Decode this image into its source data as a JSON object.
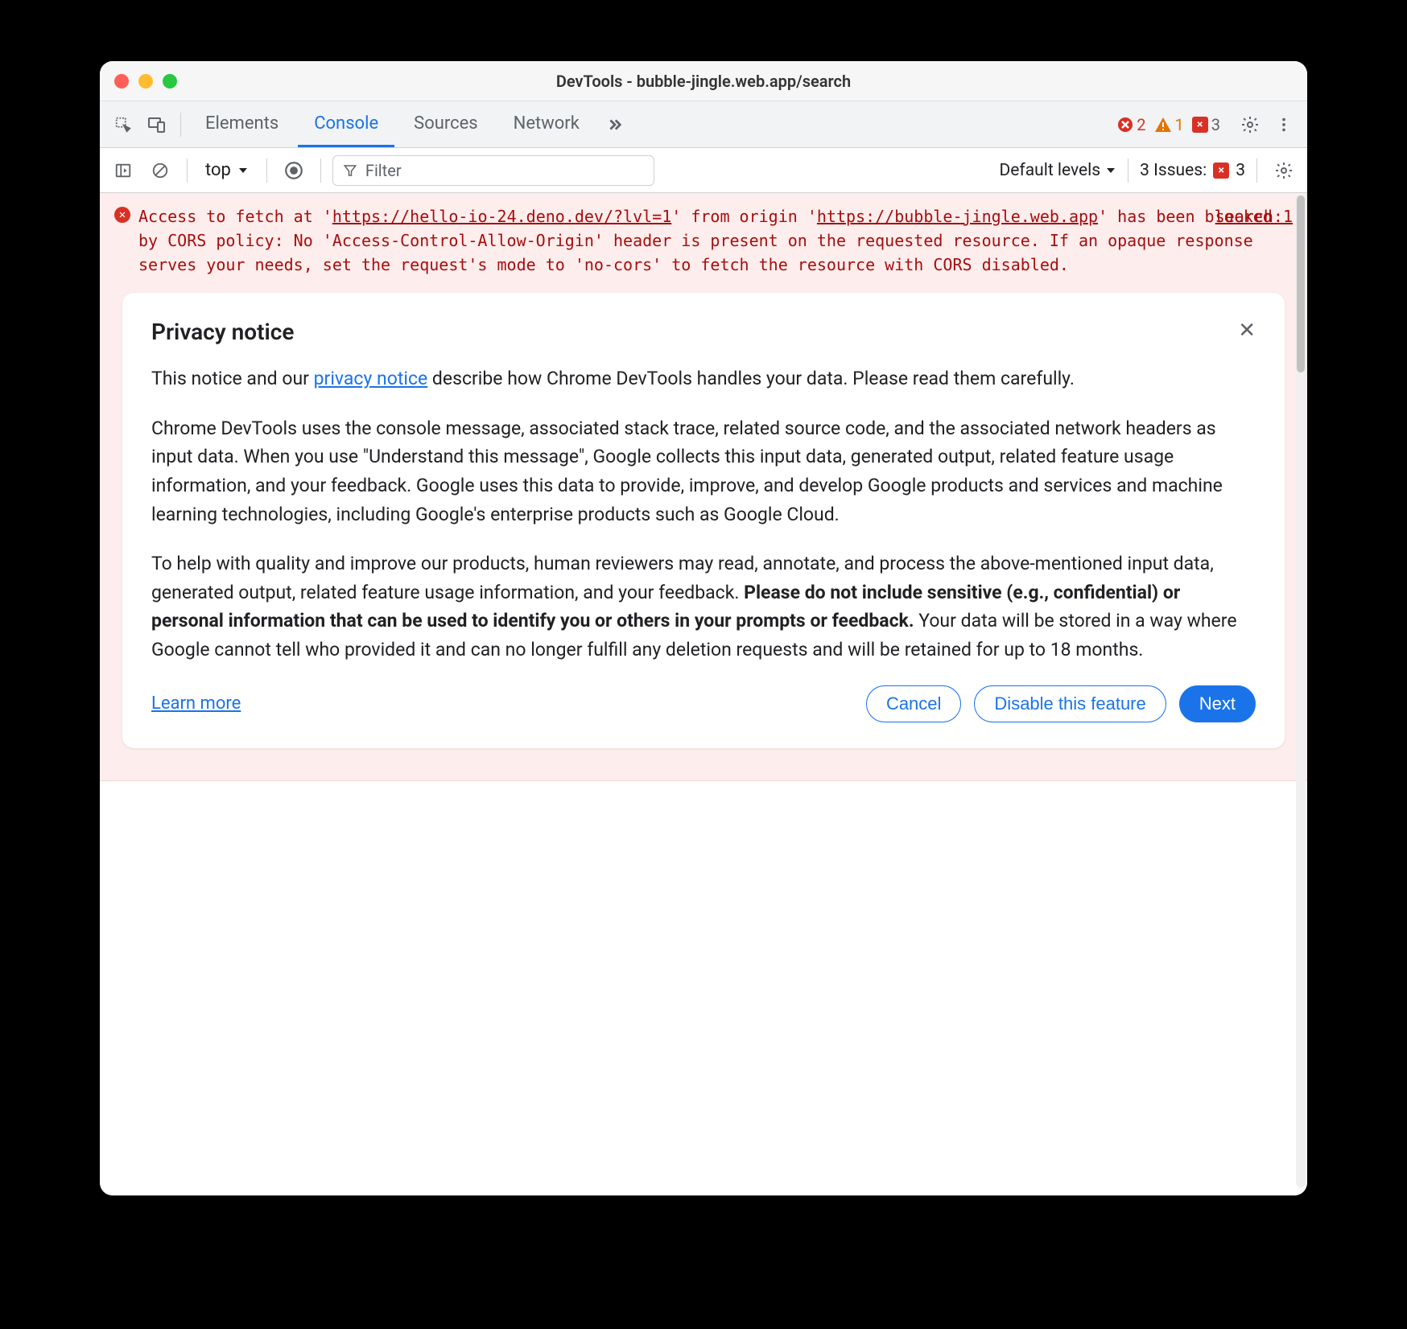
{
  "window": {
    "title": "DevTools - bubble-jingle.web.app/search"
  },
  "tabs": {
    "items": [
      "Elements",
      "Console",
      "Sources",
      "Network"
    ],
    "active": "Console"
  },
  "status": {
    "errors": "2",
    "warnings": "1",
    "messages": "3"
  },
  "filterbar": {
    "context": "top",
    "filter_placeholder": "Filter",
    "levels_label": "Default levels",
    "issues_label": "3 Issues:",
    "issues_count": "3"
  },
  "console": {
    "error": {
      "pre": "Access to fetch at '",
      "url1": "https://hello-io-24.deno.dev/?lvl=1",
      "mid1": "' from origin '",
      "url2": "https://bubble-jingle.web.app",
      "rest": "' has been blocked by CORS policy: No 'Access-Control-Allow-Origin' header is present on the requested resource. If an opaque response serves your needs, set the request's mode to 'no-cors' to fetch the resource with CORS disabled.",
      "source": "search:1"
    }
  },
  "notice": {
    "title": "Privacy notice",
    "intro_pre": "This notice and our ",
    "intro_link": "privacy notice",
    "intro_post": " describe how Chrome DevTools handles your data. Please read them carefully.",
    "p2": "Chrome DevTools uses the console message, associated stack trace, related source code, and the associated network headers as input data. When you use \"Understand this message\", Google collects this input data, generated output, related feature usage information, and your feedback. Google uses this data to provide, improve, and develop Google products and services and machine learning technologies, including Google's enterprise products such as Google Cloud.",
    "p3_pre": "To help with quality and improve our products, human reviewers may read, annotate, and process the above-mentioned input data, generated output, related feature usage information, and your feedback. ",
    "p3_bold": "Please do not include sensitive (e.g., confidential) or personal information that can be used to identify you or others in your prompts or feedback.",
    "p3_post": " Your data will be stored in a way where Google cannot tell who provided it and can no longer fulfill any deletion requests and will be retained for up to 18 months.",
    "learn_more": "Learn more",
    "cancel": "Cancel",
    "disable": "Disable this feature",
    "next": "Next"
  }
}
